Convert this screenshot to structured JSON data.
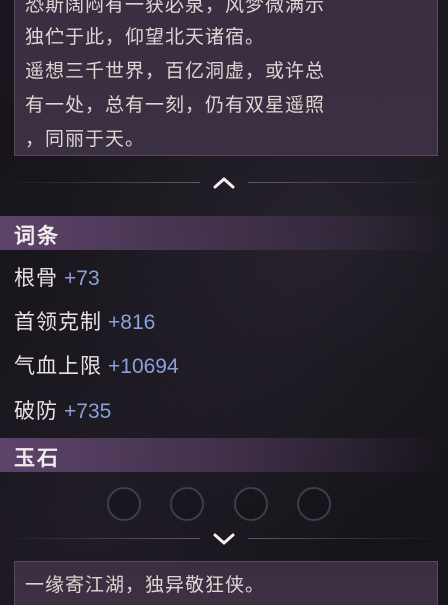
{
  "description": {
    "lines": [
      "恐斯阔闷有一获必泉，风梦微满示",
      "独伫于此，仰望北天诸宿。",
      "遥想三千世界，百亿洞虚，或许总",
      "有一处，总有一刻，仍有双星遥照",
      "，同丽于天。"
    ]
  },
  "entries": {
    "title": "词条",
    "items": [
      {
        "name": "根骨",
        "value": "+73"
      },
      {
        "name": "首领克制",
        "value": "+816"
      },
      {
        "name": "气血上限",
        "value": "+10694"
      },
      {
        "name": "破防",
        "value": "+735"
      }
    ]
  },
  "jade": {
    "title": "玉石",
    "slots": 4
  },
  "quote": {
    "text": "一缘寄江湖，独异敬狂侠。"
  },
  "colors": {
    "accent_value": "#8aa0d8",
    "panel": "#3b2f42",
    "header": "#62466e"
  }
}
